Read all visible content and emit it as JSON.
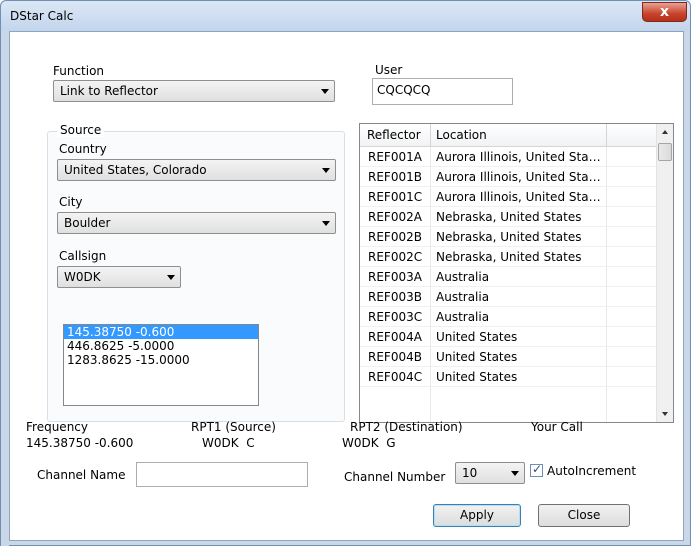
{
  "window": {
    "title": "DStar Calc",
    "close_glyph": "x"
  },
  "function": {
    "label": "Function",
    "value": "Link to Reflector"
  },
  "user": {
    "label": "User",
    "value": "CQCQCQ"
  },
  "source": {
    "group_label": "Source",
    "country_label": "Country",
    "country_value": "United States, Colorado",
    "city_label": "City",
    "city_value": "Boulder",
    "callsign_label": "Callsign",
    "callsign_value": "W0DK",
    "frequencies": [
      {
        "text": "145.38750 -0.600",
        "selected": true
      },
      {
        "text": "446.8625 -5.0000",
        "selected": false
      },
      {
        "text": "1283.8625 -15.0000",
        "selected": false
      }
    ]
  },
  "reflector_table": {
    "columns": [
      "Reflector",
      "Location"
    ],
    "rows": [
      [
        "REF001A",
        "Aurora Illinois, United Stat..."
      ],
      [
        "REF001B",
        "Aurora Illinois, United Stat..."
      ],
      [
        "REF001C",
        "Aurora Illinois, United Stat..."
      ],
      [
        "REF002A",
        "Nebraska, United States"
      ],
      [
        "REF002B",
        "Nebraska, United States"
      ],
      [
        "REF002C",
        "Nebraska, United States"
      ],
      [
        "REF003A",
        "Australia"
      ],
      [
        "REF003B",
        "Australia"
      ],
      [
        "REF003C",
        "Australia"
      ],
      [
        "REF004A",
        "United States"
      ],
      [
        "REF004B",
        "United States"
      ],
      [
        "REF004C",
        "United States"
      ]
    ]
  },
  "info": {
    "frequency_label": "Frequency",
    "frequency_value": "145.38750 -0.600",
    "rpt1_label": "RPT1 (Source)",
    "rpt1_value": "W0DK  C",
    "rpt2_label": "RPT2 (Destination)",
    "rpt2_value": "W0DK  G",
    "yourcall_label": "Your Call"
  },
  "channel": {
    "name_label": "Channel Name",
    "name_value": "",
    "number_label": "Channel Number",
    "number_value": "10",
    "autoincrement_label": "AutoIncrement",
    "autoincrement_checked": true,
    "check_glyph": "✓"
  },
  "buttons": {
    "apply": "Apply",
    "close": "Close"
  }
}
